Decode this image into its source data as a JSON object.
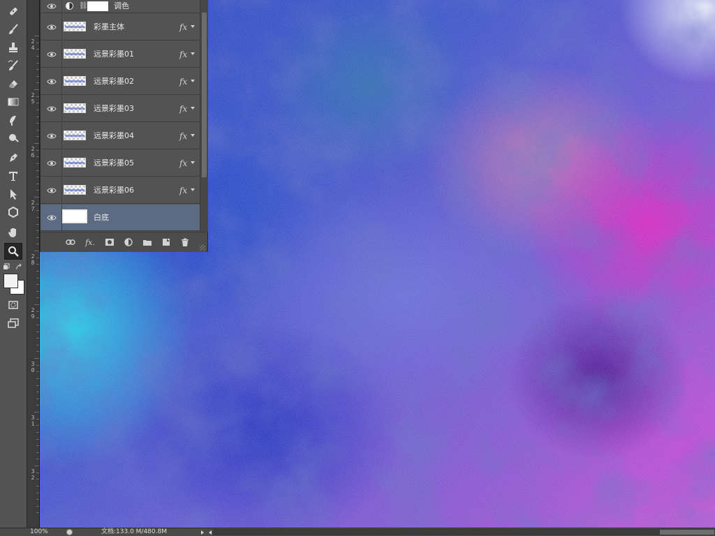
{
  "toolbar": {
    "tools": [
      "healing-brush-icon",
      "brush-icon",
      "clone-stamp-icon",
      "history-brush-icon",
      "eraser-icon",
      "gradient-icon",
      "blur-icon",
      "dodge-icon",
      "pen-icon",
      "type-icon",
      "path-selection-icon",
      "shape-icon",
      "hand-icon",
      "zoom-icon"
    ],
    "active_tool": "zoom-icon",
    "foreground_color": "#f2f2f2",
    "background_color": "#ffffff"
  },
  "ruler": {
    "labels": [
      "2\n4",
      "2\n5",
      "2\n6",
      "2\n7",
      "2\n8",
      "2\n9",
      "3\n0",
      "3\n1",
      "3\n2"
    ]
  },
  "layers_panel": {
    "adjustment_layer": {
      "name": "调色"
    },
    "layers": [
      {
        "name": "彩墨主体",
        "fx": "fx",
        "selected": false
      },
      {
        "name": "远景彩墨01",
        "fx": "fx",
        "selected": false
      },
      {
        "name": "远景彩墨02",
        "fx": "fx",
        "selected": false
      },
      {
        "name": "远景彩墨03",
        "fx": "fx",
        "selected": false
      },
      {
        "name": "远景彩墨04",
        "fx": "fx",
        "selected": false
      },
      {
        "name": "远景彩墨05",
        "fx": "fx",
        "selected": false
      },
      {
        "name": "远景彩墨06",
        "fx": "fx",
        "selected": false
      },
      {
        "name": "白底",
        "fx": "",
        "selected": true
      }
    ],
    "footer": {
      "link_icon": "link-icon",
      "fx_label": "fx.",
      "mask_icon": "mask-icon",
      "adjustment_icon": "adjustment-icon",
      "group_icon": "folder-icon",
      "new_layer_icon": "new-layer-icon",
      "delete_icon": "trash-icon"
    }
  },
  "status": {
    "zoom": "100%",
    "doc_info": "文档:133.0 M/480.8M"
  },
  "colors": {
    "panel": "#535353",
    "selected_row": "#5c6a82",
    "canvas_blue": "#2a48c0",
    "canvas_magenta": "#d02cb8",
    "canvas_cyan": "#28d2e6"
  }
}
